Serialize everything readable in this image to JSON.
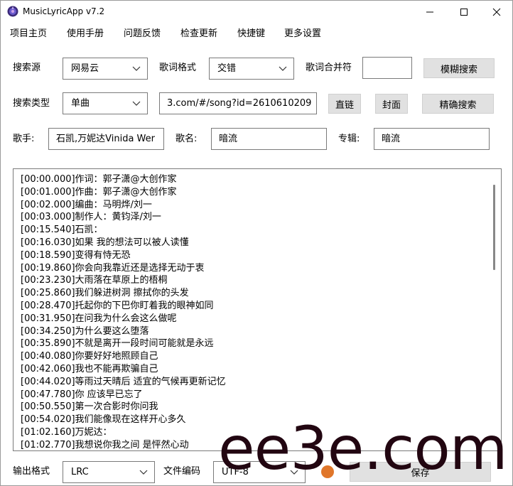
{
  "window": {
    "title": "MusicLyricApp v7.2",
    "minimize_icon": "minimize-icon",
    "maximize_icon": "maximize-icon",
    "close_icon": "close-icon"
  },
  "menu": {
    "items": [
      "项目主页",
      "使用手册",
      "问题反馈",
      "检查更新",
      "快捷键",
      "更多设置"
    ]
  },
  "search": {
    "source_label": "搜索源",
    "source_value": "网易云",
    "format_label": "歌词格式",
    "format_value": "交错",
    "merge_label": "歌词合并符",
    "merge_value": "",
    "fuzzy_button": "模糊搜索",
    "type_label": "搜索类型",
    "type_value": "单曲",
    "url_value": "3.com/#/song?id=2610610209",
    "direct_link_button": "直链",
    "cover_button": "封面",
    "exact_button": "精确搜索"
  },
  "song": {
    "singer_label": "歌手:",
    "singer_value": "石凯,万妮达Vinida Wer",
    "name_label": "歌名:",
    "name_value": "暗流",
    "album_label": "专辑:",
    "album_value": "暗流"
  },
  "lyrics": [
    "[00:00.000]作词：郭子潇@大创作家",
    "[00:01.000]作曲：郭子潇@大创作家",
    "[00:02.000]编曲：马明烨/刘一",
    "[00:03.000]制作人：黄钧泽/刘一",
    "[00:15.540]石凯：",
    "[00:16.030]如果 我的想法可以被人读懂",
    "[00:18.590]变得有恃无恐",
    "[00:19.860]你会向我靠近还是选择无动于衷",
    "[00:23.230]大雨落在草原上的梧桐",
    "[00:25.860]我们躲进树洞 擦拭你的头发",
    "[00:28.470]托起你的下巴你盯着我的眼神如同",
    "[00:31.950]在问我为什么会这么做呢",
    "[00:34.250]为什么要这么堕落",
    "[00:35.890]不就是离开一段时间可能就是永远",
    "[00:40.080]你要好好地照顾自己",
    "[00:42.060]我也不能再欺骗自己",
    "[00:44.020]等雨过天晴后 适宜的气候再更新记忆",
    "[00:47.780]你 应该早已忘了",
    "[00:50.550]第一次合影时你问我",
    "[00:54.020]我们能像现在这样开心多久",
    "[01:02.160]万妮达：",
    "[01:02.770]我想说你我之间 是怦然心动"
  ],
  "footer": {
    "output_label": "输出格式",
    "output_value": "LRC",
    "encoding_label": "文件编码",
    "encoding_value": "UTF-8",
    "save_button": "保存",
    "status_color": "#e0762a"
  },
  "watermark": "ee3e.com"
}
